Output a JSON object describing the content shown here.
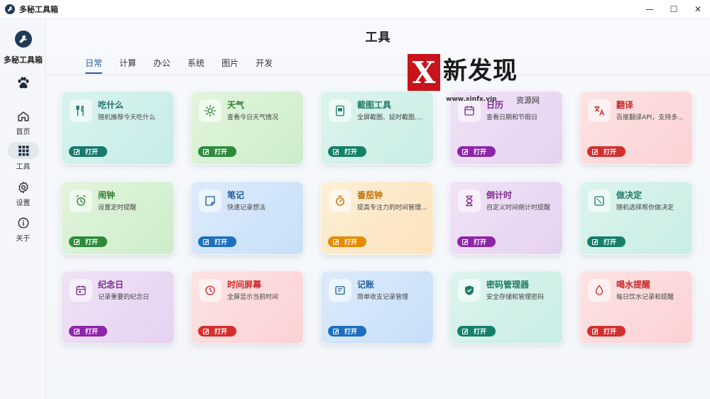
{
  "window": {
    "title": "多秘工具箱",
    "controls": {
      "minimize": "—",
      "maximize": "☐",
      "close": "✕"
    }
  },
  "sidebar": {
    "brand_name": "多秘工具箱",
    "items": [
      {
        "label": "首页",
        "icon": "home-icon",
        "active": false
      },
      {
        "label": "工具",
        "icon": "grid-icon",
        "active": true
      },
      {
        "label": "设置",
        "icon": "gear-icon",
        "active": false
      },
      {
        "label": "关于",
        "icon": "info-icon",
        "active": false
      }
    ]
  },
  "main": {
    "title": "工具",
    "tabs": [
      {
        "label": "日常",
        "active": true
      },
      {
        "label": "计算",
        "active": false
      },
      {
        "label": "办公",
        "active": false
      },
      {
        "label": "系统",
        "active": false
      },
      {
        "label": "图片",
        "active": false
      },
      {
        "label": "开发",
        "active": false
      }
    ]
  },
  "watermark": {
    "badge": "X",
    "text": "新发现",
    "url": "www.xinfx.vip",
    "subtitle": "资源网"
  },
  "open_label": "打开",
  "cards": [
    {
      "title": "吃什么",
      "desc": "随机推荐今天吃什么",
      "icon": "utensils-icon",
      "color": "teal"
    },
    {
      "title": "天气",
      "desc": "查看今日天气情况",
      "icon": "sun-icon",
      "color": "green"
    },
    {
      "title": "截图工具",
      "desc": "全屏截图、延时截图....",
      "icon": "screenshot-icon",
      "color": "mint"
    },
    {
      "title": "日历",
      "desc": "查看日期和节假日",
      "icon": "calendar-icon",
      "color": "purple"
    },
    {
      "title": "翻译",
      "desc": "百度翻译API，支持多...",
      "icon": "translate-icon",
      "color": "red"
    },
    {
      "title": "闹钟",
      "desc": "设置定时提醒",
      "icon": "alarm-icon",
      "color": "green"
    },
    {
      "title": "笔记",
      "desc": "快速记录想法",
      "icon": "note-icon",
      "color": "blue"
    },
    {
      "title": "番茄钟",
      "desc": "提高专注力的时间管理...",
      "icon": "timer-icon",
      "color": "orange"
    },
    {
      "title": "倒计时",
      "desc": "自定义时间倒计时提醒",
      "icon": "hourglass-icon",
      "color": "purple"
    },
    {
      "title": "做决定",
      "desc": "随机选择帮你做决定",
      "icon": "dice-icon",
      "color": "mint"
    },
    {
      "title": "纪念日",
      "desc": "记录重要的纪念日",
      "icon": "calendar-event-icon",
      "color": "purple"
    },
    {
      "title": "时间屏幕",
      "desc": "全屏显示当前时间",
      "icon": "clock-icon",
      "color": "red"
    },
    {
      "title": "记账",
      "desc": "简单收支记录管理",
      "icon": "wallet-icon",
      "color": "blue"
    },
    {
      "title": "密码管理器",
      "desc": "安全存储和管理密码",
      "icon": "shield-icon",
      "color": "mint"
    },
    {
      "title": "喝水提醒",
      "desc": "每日饮水记录和提醒",
      "icon": "water-drop-icon",
      "color": "red"
    }
  ]
}
